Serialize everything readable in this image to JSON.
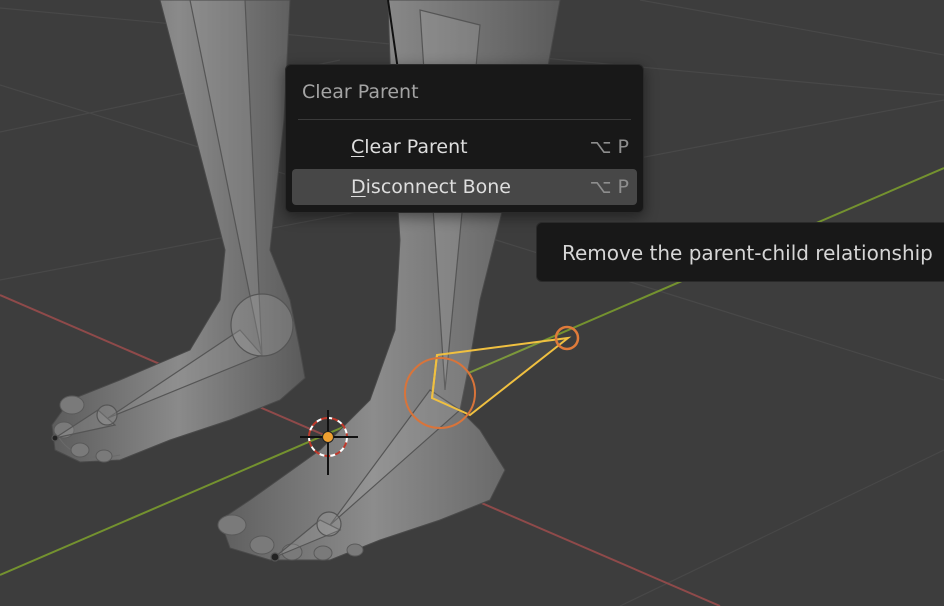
{
  "menu": {
    "title": "Clear Parent",
    "items": [
      {
        "mnemonic": "C",
        "rest": "lear Parent",
        "shortcut": "⌥ P"
      },
      {
        "mnemonic": "D",
        "rest": "isconnect Bone",
        "shortcut": "⌥ P"
      }
    ]
  },
  "tooltip": {
    "text": "Remove the parent-child relationship"
  },
  "colors": {
    "background": "#3d3d3d",
    "x_axis": "#8f4a4a",
    "y_axis": "#74922f",
    "selected_bone": "#f0c040",
    "active_joint": "#e07b3a",
    "menu_bg": "#181818",
    "menu_highlight": "#474747"
  }
}
